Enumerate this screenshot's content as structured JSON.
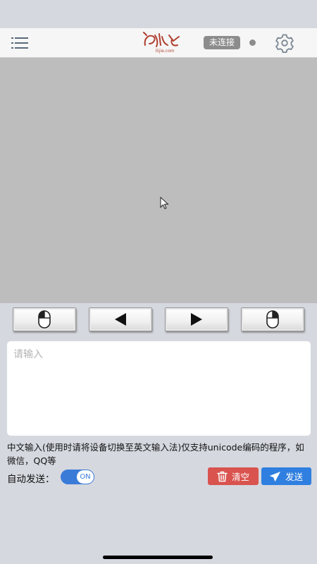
{
  "header": {
    "menu_icon": "menu-icon",
    "logo_text": "i5jie.com",
    "connection_status": "未连接",
    "settings_icon": "gear-icon"
  },
  "touchpad": {
    "cursor_icon": "mouse-pointer-icon"
  },
  "pad_buttons": [
    {
      "id": "left-click",
      "icon": "mouse-left-icon"
    },
    {
      "id": "prev",
      "icon": "triangle-left-icon"
    },
    {
      "id": "next",
      "icon": "triangle-right-icon"
    },
    {
      "id": "right-click",
      "icon": "mouse-right-icon"
    }
  ],
  "input": {
    "placeholder": "请输入",
    "value": ""
  },
  "hint_text": "中文输入(使用时请将设备切换至英文输入法)仅支持unicode编码的程序，如微信，QQ等",
  "auto_send": {
    "label": "自动发送：",
    "toggle_state": "ON"
  },
  "actions": {
    "clear_label": "清空",
    "send_label": "发送"
  },
  "colors": {
    "accent": "#2f7fe0",
    "danger": "#d9534f",
    "logo": "#b04030"
  }
}
